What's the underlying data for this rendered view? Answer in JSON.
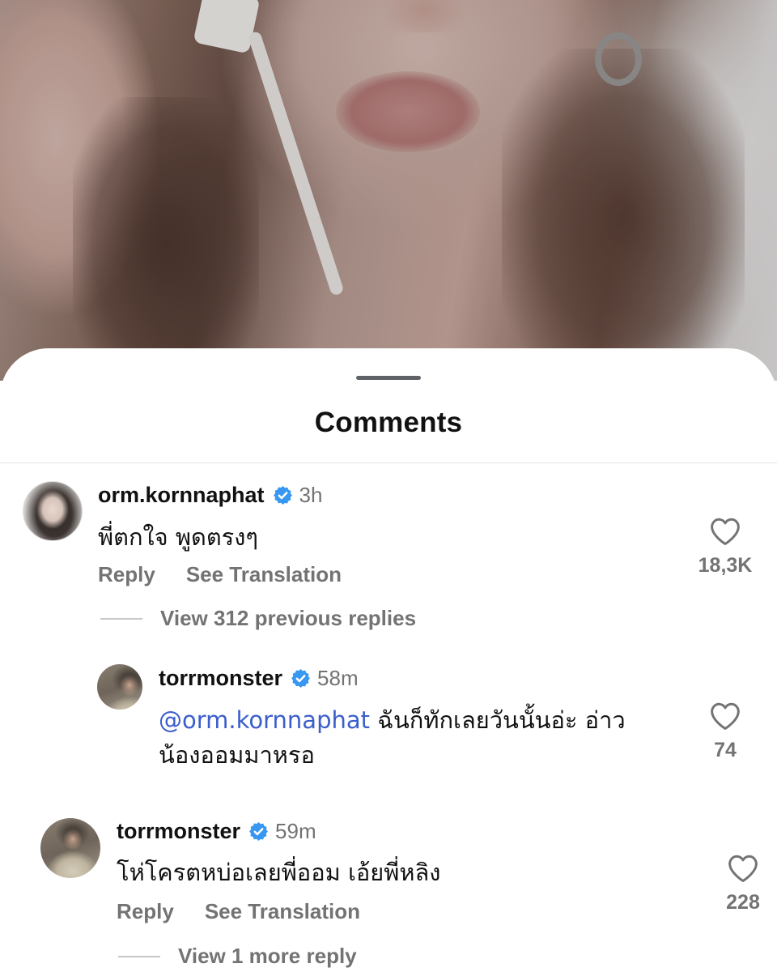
{
  "sheet": {
    "title": "Comments"
  },
  "comments": [
    {
      "username": "orm.kornnaphat",
      "time": "3h",
      "text": "พี่ตกใจ พูดตรงๆ",
      "reply_label": "Reply",
      "translate_label": "See Translation",
      "likes": "18,3K",
      "view_replies": "View 312 previous replies",
      "avatar_icon": "profile-photo"
    },
    {
      "username": "torrmonster",
      "time": "58m",
      "mention": "@orm.kornnaphat",
      "text": " ฉันก็ทักเลยวันนั้นอ่ะ  อ่าว",
      "text_line2": "น้องออมมาหรอ",
      "likes": "74",
      "avatar_icon": "profile-photo"
    },
    {
      "username": "torrmonster",
      "time": "59m",
      "text": "โห่โครตหบ่อเลยพี่ออม เอ้ยพี่หลิง",
      "reply_label": "Reply",
      "translate_label": "See Translation",
      "likes": "228",
      "view_replies": "View 1 more reply",
      "avatar_icon": "profile-photo"
    }
  ],
  "icons": {
    "verified": "verified-badge-icon",
    "like": "heart-icon"
  },
  "colors": {
    "verified": "#3897f0",
    "mention": "#3b5ecc",
    "muted": "#737373"
  }
}
